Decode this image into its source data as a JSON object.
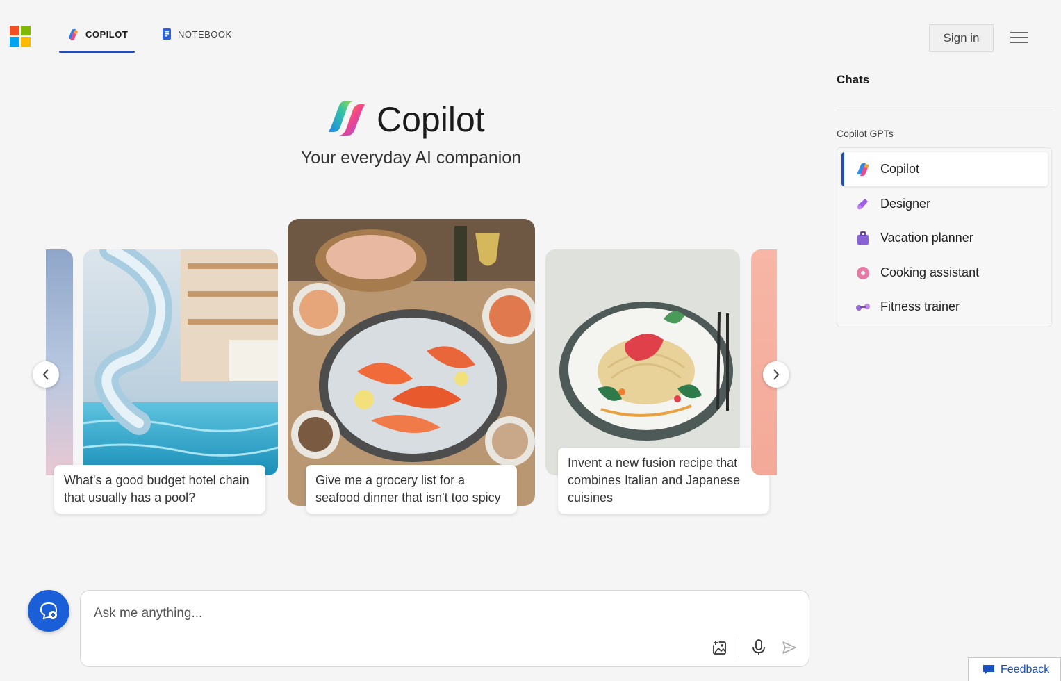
{
  "header": {
    "tabs": [
      {
        "label": "COPILOT",
        "active": true
      },
      {
        "label": "NOTEBOOK",
        "active": false
      }
    ],
    "sign_in_label": "Sign in"
  },
  "hero": {
    "title": "Copilot",
    "subtitle": "Your everyday AI companion"
  },
  "carousel": {
    "cards": [
      {
        "prompt": "What's a good budget hotel chain that usually has a pool?",
        "image": "indoor pool with water slide"
      },
      {
        "prompt": "Give me a grocery list for a seafood dinner that isn't too spicy",
        "image": "seafood platter with shrimp"
      },
      {
        "prompt": "Invent a new fusion recipe that combines Italian and Japanese cuisines",
        "image": "pasta with tuna on plate"
      }
    ]
  },
  "sidebar": {
    "title": "Chats",
    "section_label": "Copilot GPTs",
    "items": [
      {
        "label": "Copilot",
        "icon": "copilot-icon",
        "active": true
      },
      {
        "label": "Designer",
        "icon": "designer-icon",
        "active": false
      },
      {
        "label": "Vacation planner",
        "icon": "suitcase-icon",
        "active": false
      },
      {
        "label": "Cooking assistant",
        "icon": "donut-icon",
        "active": false
      },
      {
        "label": "Fitness trainer",
        "icon": "dumbbell-icon",
        "active": false
      }
    ]
  },
  "composer": {
    "placeholder": "Ask me anything..."
  },
  "feedback_label": "Feedback",
  "colors": {
    "accent": "#1a4fc4",
    "new_topic_button": "#1a5fd8",
    "background": "#f5f5f5"
  }
}
